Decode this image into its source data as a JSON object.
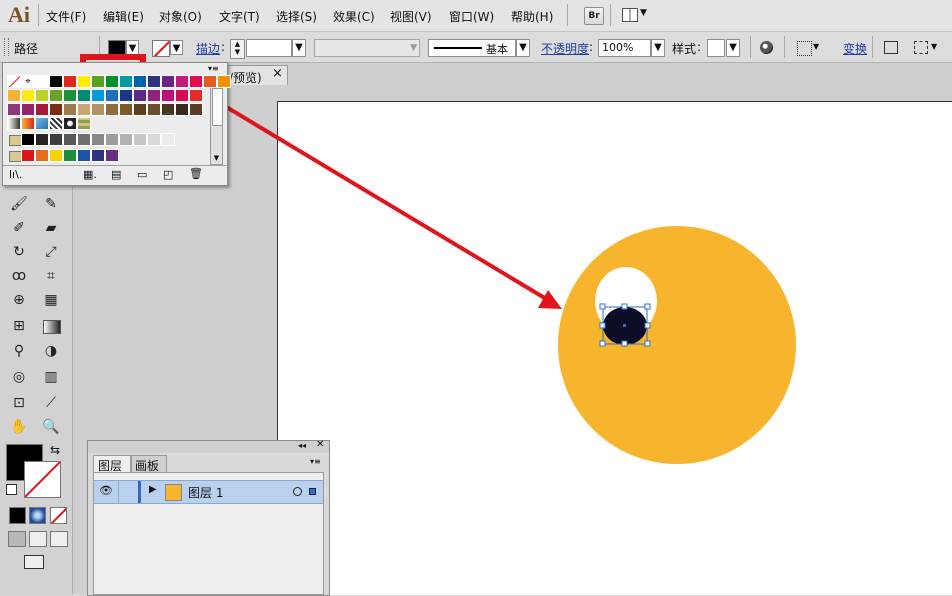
{
  "app": {
    "logo": "Ai"
  },
  "menu": [
    "文件(F)",
    "编辑(E)",
    "对象(O)",
    "文字(T)",
    "选择(S)",
    "效果(C)",
    "视图(V)",
    "窗口(W)",
    "帮助(H)"
  ],
  "menu_extra": {
    "bridge_label": "Br"
  },
  "control": {
    "selection_type": "路径",
    "stroke_label": "描边",
    "stroke_style_label": "基本",
    "opacity_label": "不透明度",
    "opacity_value": "100%",
    "style_label": "样式",
    "transform_label": "变换"
  },
  "document": {
    "tab_title": "/预览)",
    "close_glyph": "×"
  },
  "layers": {
    "tabs": [
      "图层",
      "画板"
    ],
    "layer_name": "图层 1"
  },
  "colors": {
    "accent_red": "#e0141a",
    "circle_fill": "#f7b52e",
    "selected_fill": "#0b0e24",
    "selection_blue": "#2f6fd0",
    "layer_row": "#b9d1ee"
  },
  "swatches": {
    "row1": [
      "#ffffff",
      "#000000",
      "#e0271b",
      "#ffed00",
      "#58a31e",
      "#00912e",
      "#009aa6",
      "#0062b0",
      "#2a3384",
      "#6b2483",
      "#c01c79",
      "#e40c4e",
      "#e95a1f",
      "#f39100"
    ],
    "row2": [
      "#f9b233",
      "#fcea10",
      "#bcd22a",
      "#68a62b",
      "#1e8f3a",
      "#008b70",
      "#009cda",
      "#1d71b8",
      "#1c3687",
      "#5a2b83",
      "#94217f",
      "#c0107c",
      "#d40d53",
      "#e32d24"
    ],
    "row3": [
      "#91367e",
      "#952468",
      "#a8173c",
      "#7d2d14",
      "#9d7b4a",
      "#c6a875",
      "#b29466",
      "#8f6c3c",
      "#7c5927",
      "#603f1c",
      "#6e4e2d",
      "#4b3621",
      "#382a1c",
      "#5a3d26"
    ],
    "gray_row": [
      "#000000",
      "#242424",
      "#3c3c3c",
      "#575757",
      "#6f6f6f",
      "#878787",
      "#9d9d9d",
      "#b2b2b2",
      "#c6c6c6",
      "#dadada",
      "#ececec"
    ],
    "bright_row": [
      "#e0141a",
      "#ea6a1b",
      "#fcd300",
      "#1f8e3c",
      "#1a54a8",
      "#2f327f",
      "#6b2d8b"
    ]
  }
}
